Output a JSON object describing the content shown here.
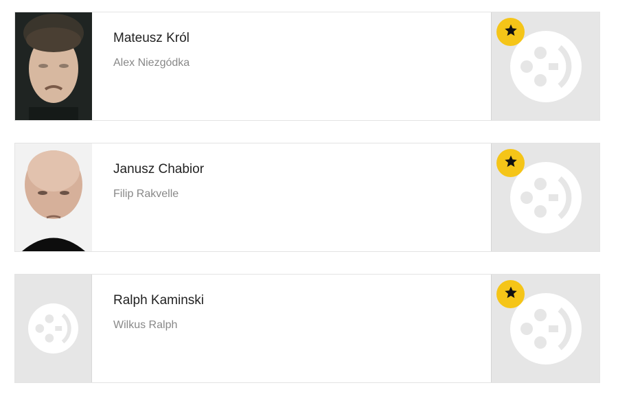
{
  "cast": [
    {
      "actor_name": "Mateusz Król",
      "role_name": "Alex Niezgódka",
      "photo": "portrait-photo",
      "badge_icon": "star-icon"
    },
    {
      "actor_name": "Janusz Chabior",
      "role_name": "Filip Rakvelle",
      "photo": "portrait-photo",
      "badge_icon": "star-icon"
    },
    {
      "actor_name": "Ralph Kaminski",
      "role_name": "Wilkus Ralph",
      "photo": "placeholder",
      "badge_icon": "star-icon"
    }
  ],
  "colors": {
    "badge": "#f5c518",
    "placeholder_bg": "#e6e6e6",
    "actor_text": "#222222",
    "role_text": "#888888"
  }
}
